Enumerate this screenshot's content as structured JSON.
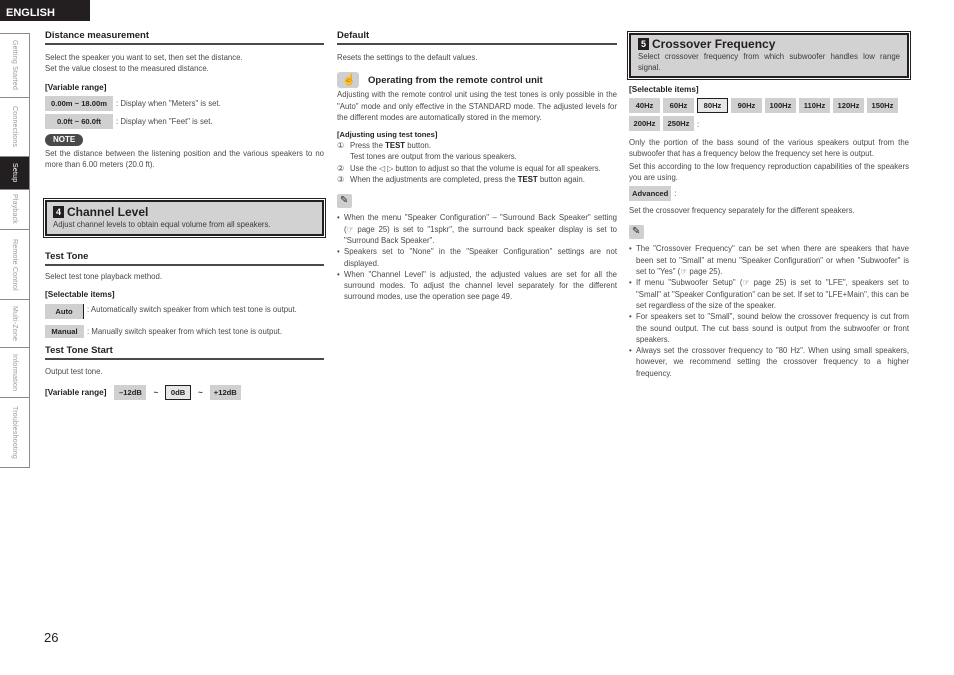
{
  "header": {
    "language": "ENGLISH"
  },
  "sidebar": {
    "items": [
      {
        "label": "Getting Started",
        "active": false
      },
      {
        "label": "Connections",
        "active": false
      },
      {
        "label": "Setup",
        "active": true
      },
      {
        "label": "Playback",
        "active": false
      },
      {
        "label": "Remote Control",
        "active": false
      },
      {
        "label": "Multi-Zone",
        "active": false
      },
      {
        "label": "Information",
        "active": false
      },
      {
        "label": "Troubleshooting",
        "active": false
      }
    ]
  },
  "distance": {
    "title": "Distance measurement",
    "desc1": "Select the speaker you want to set, then set the distance.",
    "desc2": "Set the value closest to the measured distance.",
    "range_label": "[Variable range]",
    "ranges": [
      {
        "value": "0.00m ~ 18.00m",
        "desc": ": Display when \"Meters\" is set."
      },
      {
        "value": "0.0ft ~ 60.0ft",
        "desc": ": Display when \"Feet\" is set."
      }
    ],
    "note_label": "NOTE",
    "note_text": "Set the distance between the listening position and the various speakers to no more than 6.00 meters (20.0 ft)."
  },
  "channel_level": {
    "number": "4",
    "title": "Channel Level",
    "desc": "Adjust channel levels to obtain equal volume from all speakers."
  },
  "test_tone": {
    "title": "Test Tone",
    "desc": "Select test tone playback method.",
    "items_label": "[Selectable items]",
    "items": [
      {
        "value": "Auto",
        "desc": ": Automatically switch speaker from which test tone is output."
      },
      {
        "value": "Manual",
        "desc": ": Manually switch speaker from which test tone is output."
      }
    ]
  },
  "test_tone_start": {
    "title": "Test Tone Start",
    "desc": "Output test tone.",
    "range_label": "[Variable range]",
    "min": "–12dB",
    "sep": "~",
    "default": "0dB",
    "max": "+12dB"
  },
  "default": {
    "title": "Default",
    "desc": "Resets the settings to the default values."
  },
  "remote": {
    "title": "Operating from the remote control unit",
    "desc": "Adjusting with the remote control unit using the test tones is only possible in the \"Auto\" mode and only effective in the STANDARD mode. The adjusted levels for the different modes are automatically stored in the memory.",
    "steps_label": "[Adjusting using test tones]",
    "steps": [
      {
        "num": "①",
        "pre": "Press the ",
        "key": "TEST",
        "post": " button.",
        "sub": "Test tones are output from the various speakers."
      },
      {
        "num": "②",
        "text": "Use the ◁ ▷ button to adjust so that the volume is equal for all speakers."
      },
      {
        "num": "③",
        "pre": "When the adjustments are completed, press the ",
        "key": "TEST",
        "post": " button again."
      }
    ],
    "notes": [
      "When the menu \"Speaker Configuration\" – \"Surround Back Speaker\" setting (☞ page 25) is set to \"1spkr\", the surround back speaker display is set to \"Surround Back Speaker\".",
      "Speakers set to \"None\" in the \"Speaker Configuration\" settings are not displayed.",
      "When \"Channel Level\" is adjusted, the adjusted values are set for all the surround modes. To adjust the channel level separately for the different surround modes, use the operation see page 49."
    ]
  },
  "crossover": {
    "number": "5",
    "title": "Crossover Frequency",
    "desc": "Select crossover frequency from which subwoofer handles low range signal.",
    "items_label": "[Selectable items]",
    "freqs": [
      "40Hz",
      "60Hz",
      "80Hz",
      "90Hz",
      "100Hz",
      "110Hz",
      "120Hz",
      "150Hz",
      "200Hz",
      "250Hz"
    ],
    "selected": "80Hz",
    "colon": ":",
    "explain1": "Only the portion of the bass sound of the various speakers output from the subwoofer that has a frequency below the frequency set here is output.",
    "explain2": "Set this according to the low frequency reproduction capabilities of the speakers you are using.",
    "advanced_label": "Advanced",
    "advanced_desc": "Set the crossover frequency separately for the different speakers.",
    "notes": [
      "The \"Crossover Frequency\" can be set when there are speakers that have been set to \"Small\" at menu \"Speaker Configuration\" or when \"Subwoofer\" is set to \"Yes\" (☞ page 25).",
      "If menu \"Subwoofer Setup\" (☞ page 25) is set to \"LFE\", speakers set to \"Small\" at \"Speaker Configuration\" can be set. If set to \"LFE+Main\", this can be set regardless of the size of the speaker.",
      "For speakers set to \"Small\", sound below the crossover frequency is cut from the sound output. The cut bass sound is output from the subwoofer or front speakers.",
      "Always set the crossover frequency to \"80 Hz\". When using small speakers, however, we recommend setting the crossover frequency to a higher frequency."
    ]
  },
  "footer": {
    "page_number": "26"
  }
}
